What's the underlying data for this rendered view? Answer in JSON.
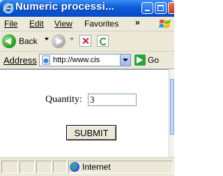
{
  "window": {
    "title": "Numeric processi..."
  },
  "menu": {
    "file": "File",
    "edit": "Edit",
    "view": "View",
    "favorites": "Favorites",
    "overflow": "»"
  },
  "toolbar": {
    "back_label": "Back"
  },
  "address": {
    "label": "Address",
    "value": "http://www.cis",
    "go_label": "Go"
  },
  "form": {
    "quantity_label": "Quantity:",
    "quantity_value": "3",
    "submit_label": "SUBMIT"
  },
  "status": {
    "zone": "Internet"
  },
  "colors": {
    "titlebar": "#0a5bd9",
    "chrome": "#ece9d8",
    "field_border": "#7f9db9"
  }
}
